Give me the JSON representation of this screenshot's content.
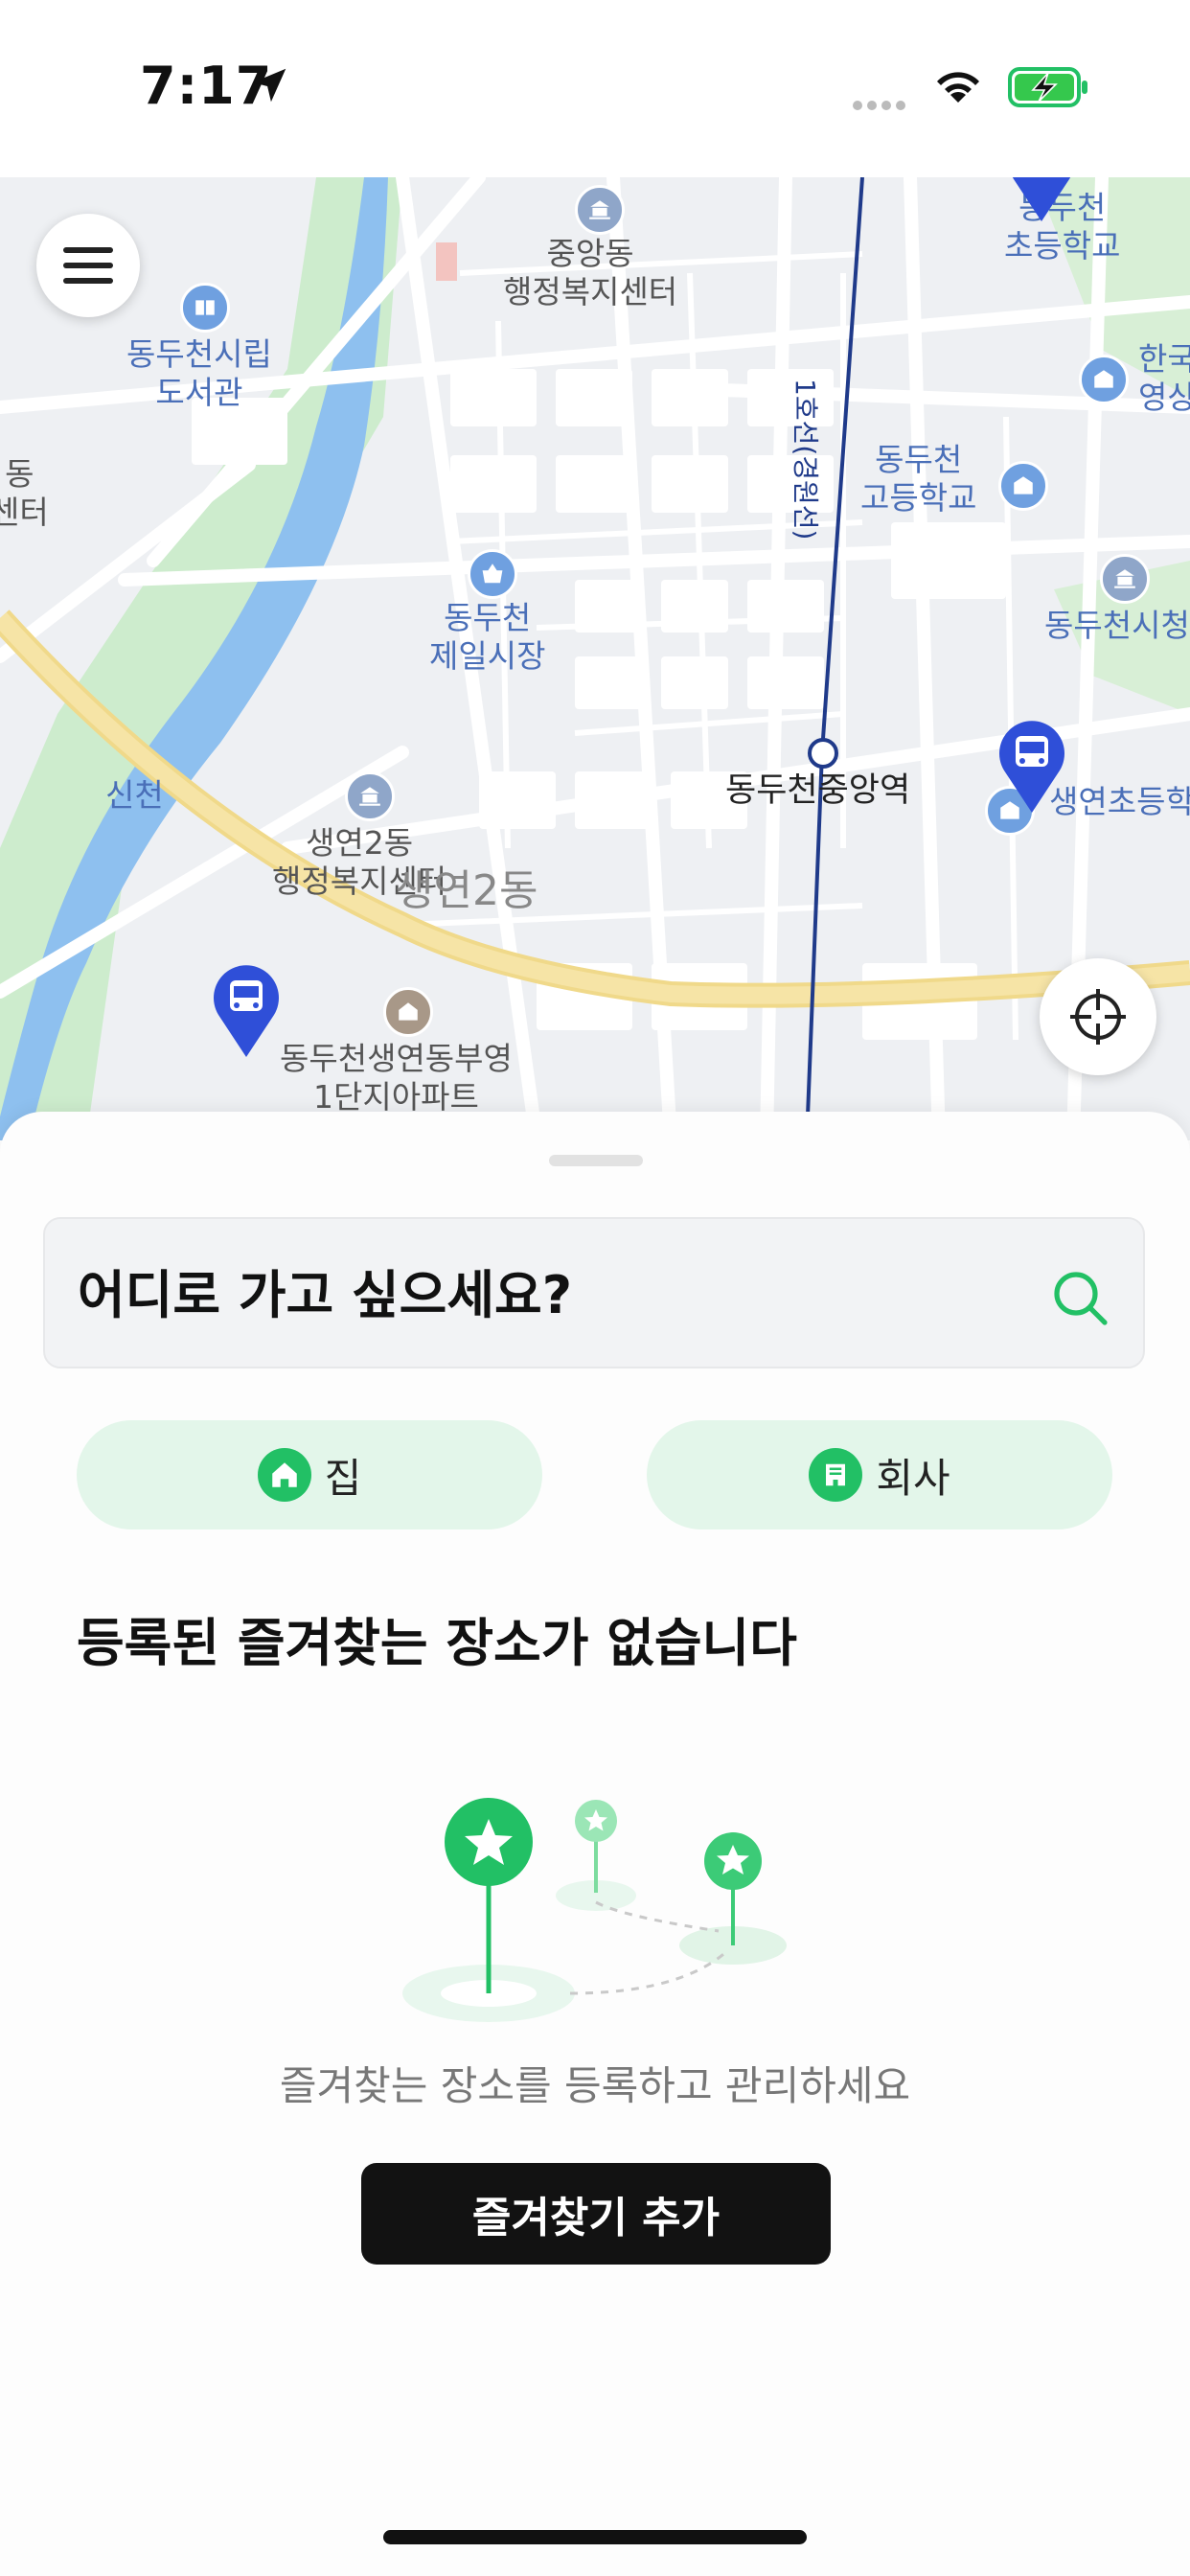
{
  "status_bar": {
    "time": "7:17"
  },
  "map": {
    "labels": {
      "dongducheon_elementary": "동두천\n초등학교",
      "jungang_dong": "중앙동\n행정복지센터",
      "library": "동두천시립\n도서관",
      "korea_partial": "한국\n영상",
      "dongducheon_highschool": "동두천\n고등학교",
      "left_center_partial": "동\n센터",
      "jeil_market": "동두천\n제일시장",
      "city_hall_partial": "동두천시청",
      "sincheon": "신천",
      "jungang_station": "동두천중앙역",
      "saengyeon_elementary": "생연초등학",
      "saengyeon2_center": "생연2동\n행정복지센터",
      "saengyeon2_area": "생연2동",
      "apartment": "동두천생연동부영\n1단지아파트",
      "rail_line": "1호선(경원선)"
    },
    "icons": {
      "menu": "hamburger-menu-icon",
      "locate": "crosshair-icon",
      "bus": "bus-stop-pin-icon"
    }
  },
  "sheet": {
    "search": {
      "placeholder": "어디로 가고 싶으세요?",
      "icon": "search-icon"
    },
    "quick": {
      "home_label": "집",
      "work_label": "회사",
      "home_icon": "home-icon",
      "work_icon": "building-icon"
    },
    "empty": {
      "title": "등록된 즐겨찾는 장소가 없습니다",
      "description": "즐겨찾는 장소를 등록하고 관리하세요",
      "button": "즐겨찾기 추가"
    }
  },
  "colors": {
    "accent": "#22c065",
    "pin": "#2f4fd8",
    "rail": "#1f3a8a"
  }
}
